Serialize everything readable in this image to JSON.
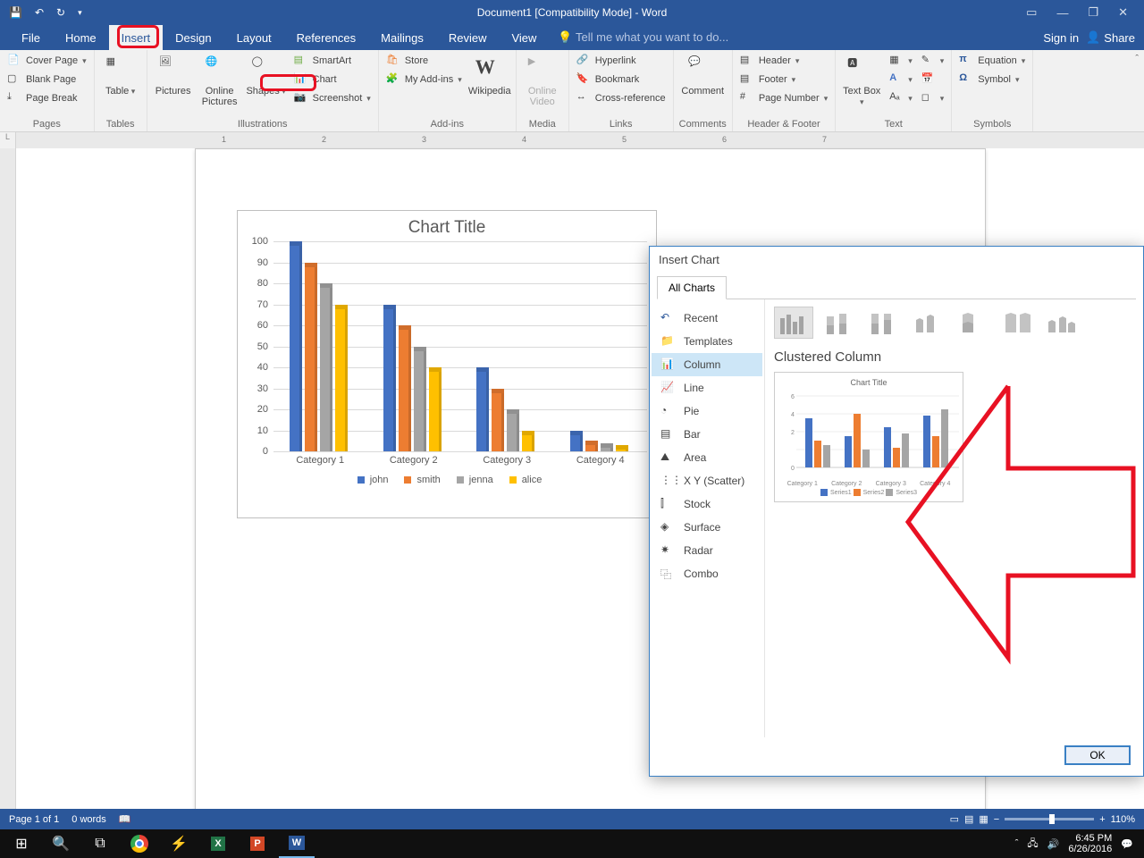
{
  "titlebar": {
    "title": "Document1 [Compatibility Mode] - Word"
  },
  "tabs": {
    "file": "File",
    "home": "Home",
    "insert": "Insert",
    "design": "Design",
    "layout": "Layout",
    "references": "References",
    "mailings": "Mailings",
    "review": "Review",
    "view": "View",
    "tellme": "Tell me what you want to do...",
    "signin": "Sign in",
    "share": "Share"
  },
  "ribbon": {
    "pages": {
      "cover": "Cover Page",
      "blank": "Blank Page",
      "break": "Page Break",
      "group": "Pages"
    },
    "tables": {
      "table": "Table",
      "group": "Tables"
    },
    "illus": {
      "pictures": "Pictures",
      "online": "Online Pictures",
      "shapes": "Shapes",
      "smartart": "SmartArt",
      "chart": "Chart",
      "screenshot": "Screenshot",
      "group": "Illustrations"
    },
    "addins": {
      "store": "Store",
      "myaddins": "My Add-ins",
      "wiki": "Wikipedia",
      "group": "Add-ins"
    },
    "media": {
      "video": "Online Video",
      "group": "Media"
    },
    "links": {
      "hyper": "Hyperlink",
      "bookmark": "Bookmark",
      "cross": "Cross-reference",
      "group": "Links"
    },
    "comments": {
      "comment": "Comment",
      "group": "Comments"
    },
    "hf": {
      "header": "Header",
      "footer": "Footer",
      "pageno": "Page Number",
      "group": "Header & Footer"
    },
    "text": {
      "textbox": "Text Box",
      "group": "Text"
    },
    "symbols": {
      "eq": "Equation",
      "sym": "Symbol",
      "group": "Symbols"
    }
  },
  "chart_data": {
    "type": "bar",
    "title": "Chart Title",
    "categories": [
      "Category 1",
      "Category 2",
      "Category 3",
      "Category 4"
    ],
    "series": [
      {
        "name": "john",
        "color": "#4472c4",
        "values": [
          100,
          70,
          40,
          10
        ]
      },
      {
        "name": "smith",
        "color": "#ed7d31",
        "values": [
          90,
          60,
          30,
          5
        ]
      },
      {
        "name": "jenna",
        "color": "#a5a5a5",
        "values": [
          80,
          50,
          20,
          4
        ]
      },
      {
        "name": "alice",
        "color": "#ffc000",
        "values": [
          70,
          40,
          10,
          3
        ]
      }
    ],
    "ylim": [
      0,
      100
    ],
    "ystep": 10
  },
  "dialog": {
    "title": "Insert Chart",
    "tab": "All Charts",
    "nav": {
      "recent": "Recent",
      "templates": "Templates",
      "column": "Column",
      "line": "Line",
      "pie": "Pie",
      "bar": "Bar",
      "area": "Area",
      "scatter": "X Y (Scatter)",
      "stock": "Stock",
      "surface": "Surface",
      "radar": "Radar",
      "combo": "Combo"
    },
    "subtitle": "Clustered Column",
    "preview": {
      "title": "Chart Title",
      "cats": [
        "Category 1",
        "Category 2",
        "Category 3",
        "Category 4"
      ],
      "legend": [
        "Series1",
        "Series2",
        "Series3"
      ]
    },
    "ok": "OK"
  },
  "statusbar": {
    "page": "Page 1 of 1",
    "words": "0 words",
    "zoom": "110%"
  },
  "taskbar": {
    "time": "6:45 PM",
    "date": "6/26/2016"
  },
  "ruler_nums": [
    "1",
    "2",
    "3",
    "4",
    "5",
    "6",
    "7"
  ]
}
